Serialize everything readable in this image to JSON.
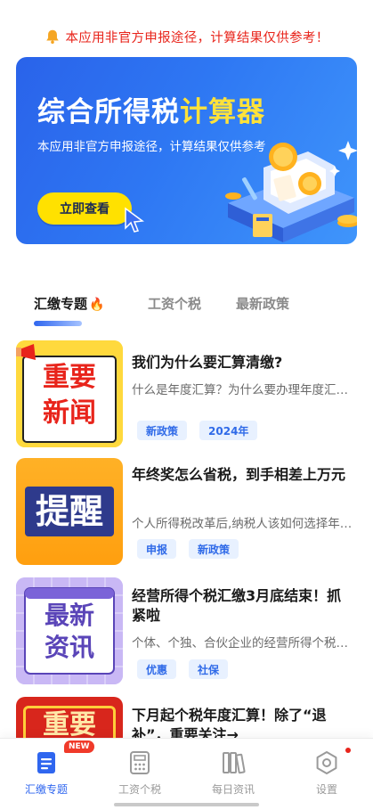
{
  "notice": {
    "icon": "bell-icon",
    "text": "本应用非官方申报途径，计算结果仅供参考！",
    "color": "#e8241b"
  },
  "banner": {
    "title_main": "综合所得税",
    "title_highlight": "计算器",
    "subtitle": "本应用非官方申报途径，计算结果仅供参考",
    "cta_label": "立即查看",
    "colors": {
      "bg_start": "#2a63ea",
      "bg_end": "#3f95fb",
      "highlight": "#ffe23a",
      "cta": "#ffe100"
    }
  },
  "tabs": [
    {
      "label": "汇缴专题",
      "active": true,
      "icon": "fire-icon"
    },
    {
      "label": "工资个税",
      "active": false
    },
    {
      "label": "最新政策",
      "active": false
    }
  ],
  "news": [
    {
      "thumb": {
        "lines": [
          "重要",
          "新闻"
        ],
        "style": "yellow-megaphone"
      },
      "title": "我们为什么要汇算清缴?",
      "summary": "什么是年度汇算？为什么要办理年度汇算?",
      "tags": [
        "新政策",
        "2024年"
      ]
    },
    {
      "thumb": {
        "lines": [
          "提醒"
        ],
        "style": "orange"
      },
      "title": "年终奖怎么省税，到手相差上万元",
      "summary": "个人所得税改革后,纳税人该如何选择年终奖",
      "tags": [
        "申报",
        "新政策"
      ]
    },
    {
      "thumb": {
        "lines": [
          "最新",
          "资讯"
        ],
        "style": "purple-grid"
      },
      "title": "经营所得个税汇缴3月底结束！抓紧啦",
      "summary": "个体、个独、合伙企业的经营所得个税汇缴",
      "tags": [
        "优惠",
        "社保"
      ]
    },
    {
      "thumb": {
        "lines": [
          "重要"
        ],
        "style": "red"
      },
      "title": "下月起个税年度汇算！除了“退补”，重要关注→",
      "summary": "",
      "tags": []
    }
  ],
  "nav": {
    "items": [
      {
        "label": "汇缴专题",
        "icon": "document-icon",
        "active": true,
        "badge": "NEW"
      },
      {
        "label": "工资个税",
        "icon": "calculator-icon",
        "active": false
      },
      {
        "label": "每日资讯",
        "icon": "books-icon",
        "active": false
      },
      {
        "label": "设置",
        "icon": "settings-icon",
        "active": false,
        "dot": true
      }
    ],
    "active_color": "#2f66ef"
  }
}
